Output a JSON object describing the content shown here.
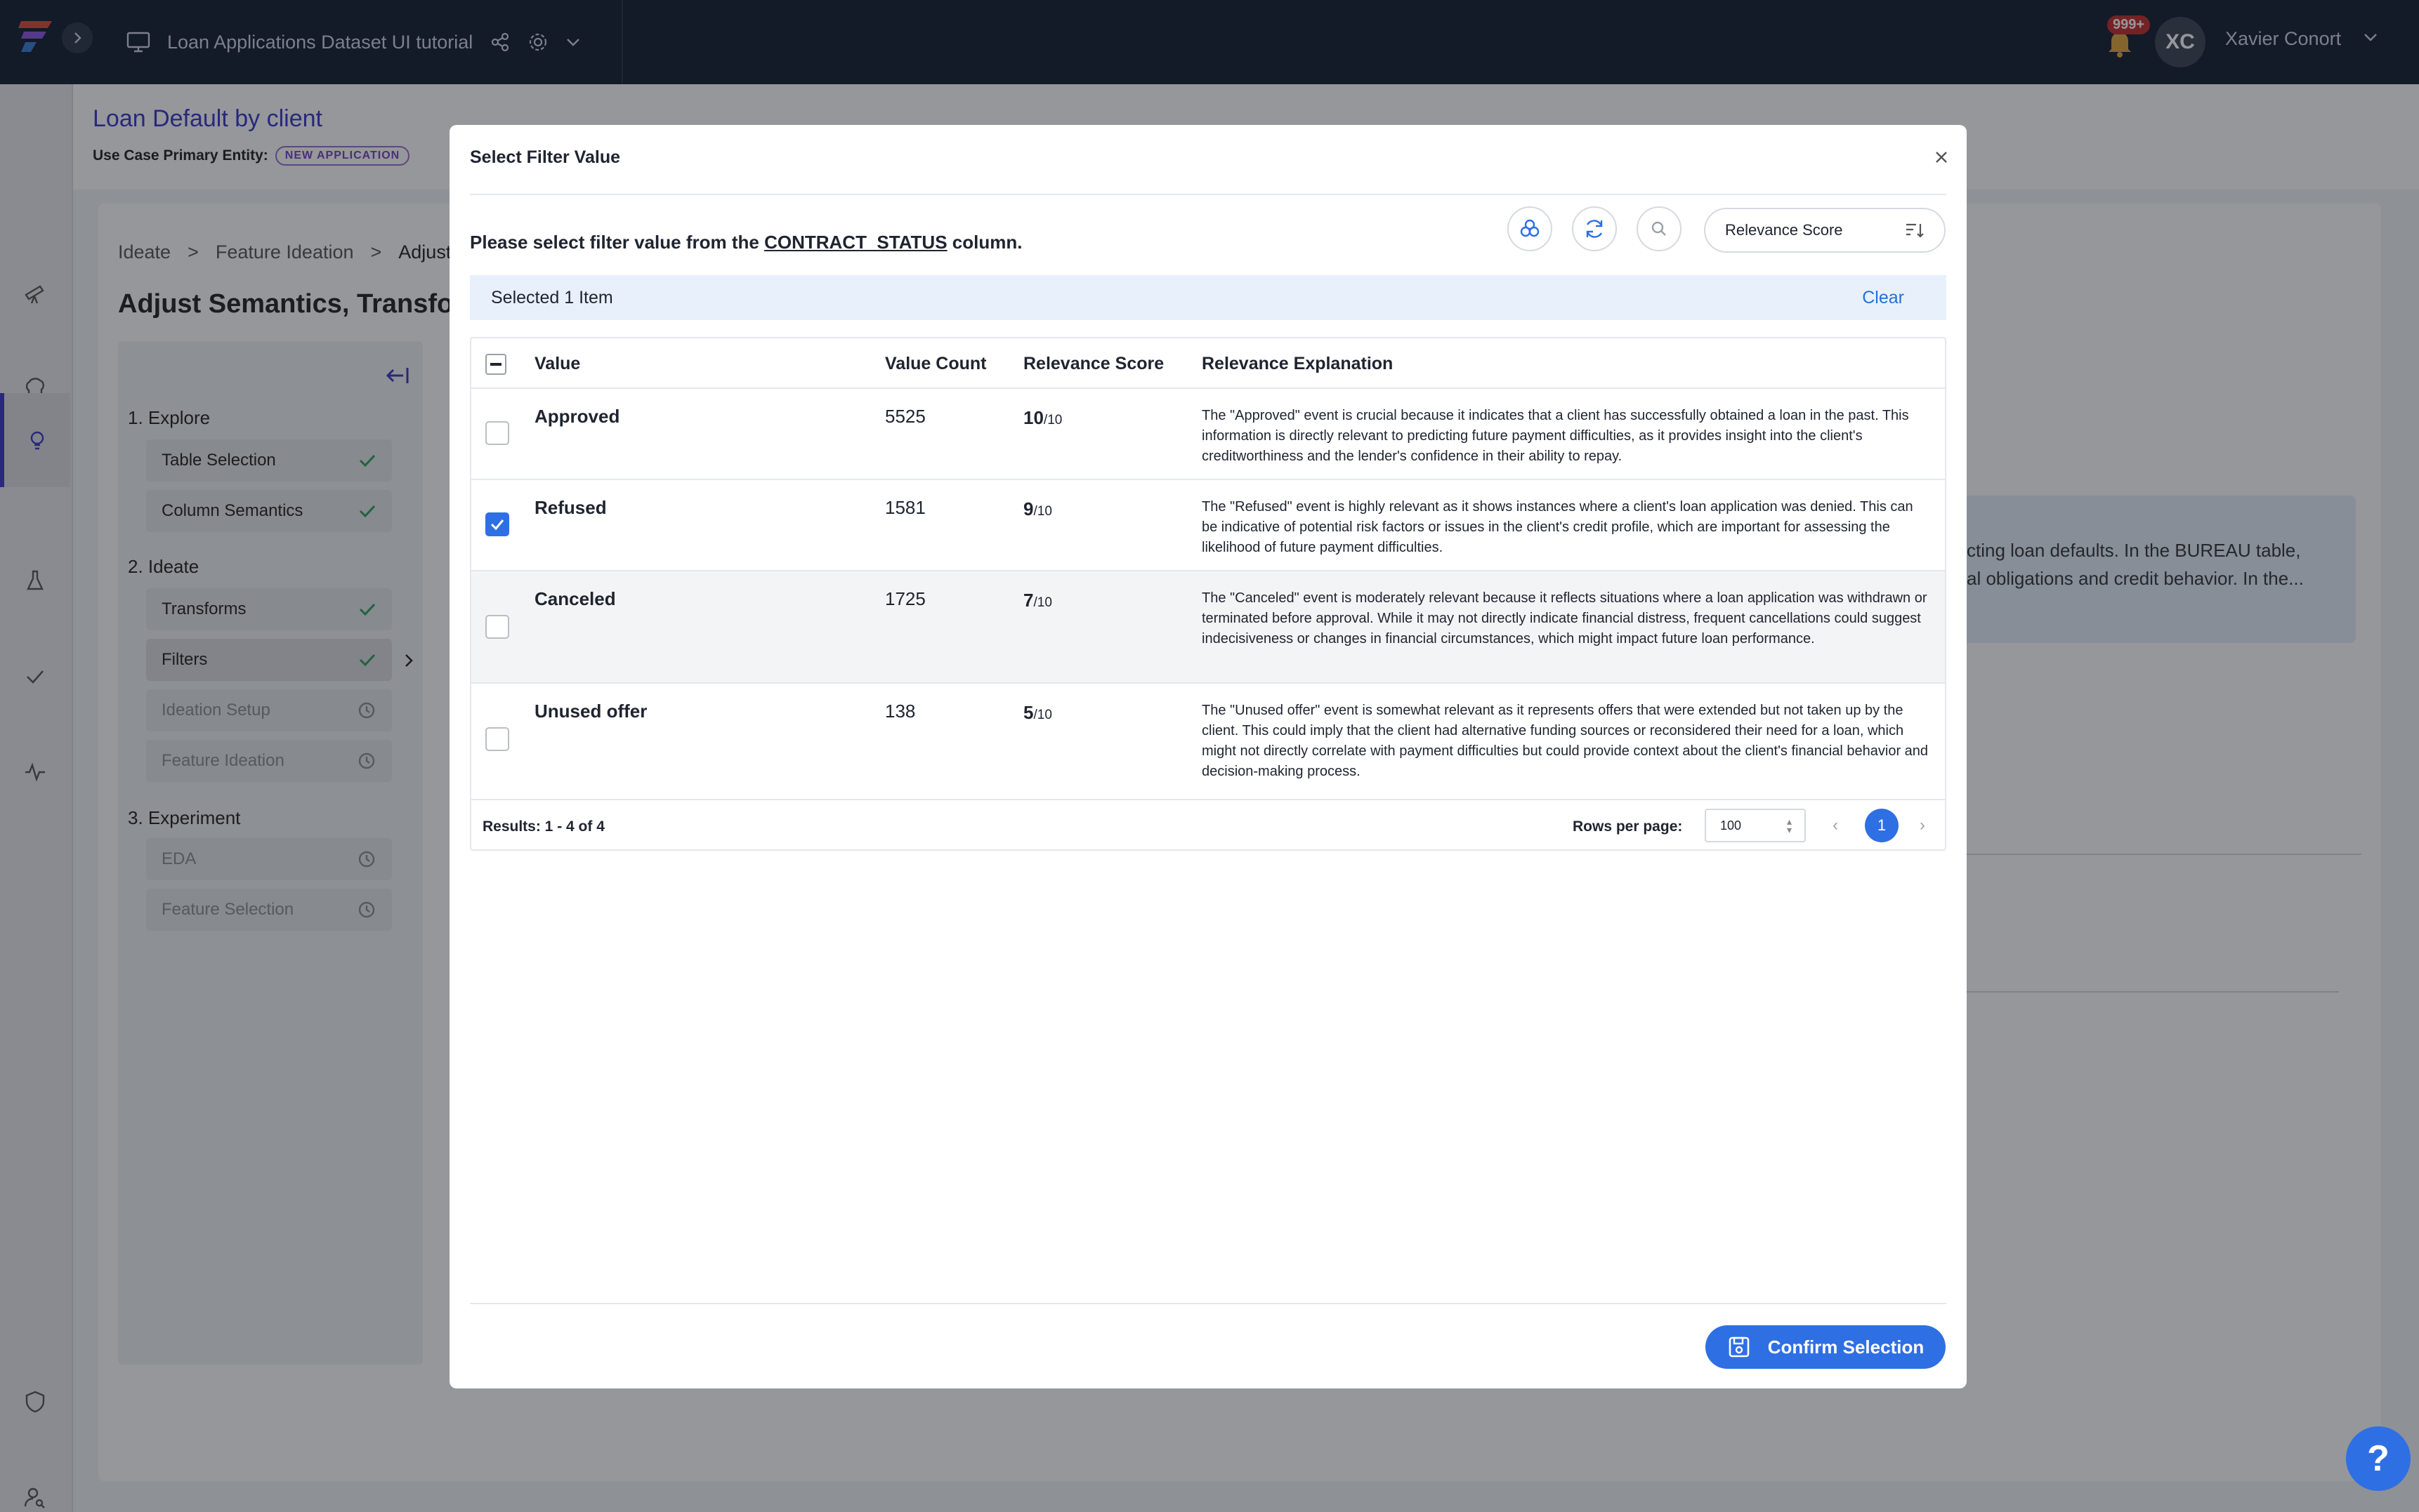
{
  "topbar": {
    "project_title": "Loan Applications Dataset UI tutorial",
    "notification_count": "999+",
    "user_initials": "XC",
    "user_name": "Xavier Conort"
  },
  "page": {
    "title": "Loan Default by client",
    "entity_label": "Use Case Primary Entity:",
    "entity_badge": "NEW APPLICATION",
    "breadcrumb": [
      "Ideate",
      ">",
      "Feature Ideation",
      ">",
      "Adjust S"
    ],
    "section_title": "Adjust Semantics, Transfor",
    "bg_info_lines": [
      "cting loan defaults. In the BUREAU table,",
      "al obligations and credit behavior. In the..."
    ]
  },
  "steps": {
    "groups": [
      {
        "label": "1. Explore"
      },
      {
        "label": "2. Ideate"
      },
      {
        "label": "3. Experiment"
      }
    ],
    "items": [
      {
        "label": "Table Selection",
        "status": "done"
      },
      {
        "label": "Column Semantics",
        "status": "done"
      },
      {
        "label": "Transforms",
        "status": "done"
      },
      {
        "label": "Filters",
        "status": "done"
      },
      {
        "label": "Ideation Setup",
        "status": "pending"
      },
      {
        "label": "Feature Ideation",
        "status": "pending"
      },
      {
        "label": "EDA",
        "status": "pending"
      },
      {
        "label": "Feature Selection",
        "status": "pending"
      }
    ]
  },
  "modal": {
    "title": "Select Filter Value",
    "prompt_prefix": "Please select filter value from the ",
    "column_name": "CONTRACT_STATUS",
    "prompt_suffix": " column.",
    "sort_label": "Relevance Score",
    "selected_text": "Selected 1 Item",
    "clear_label": "Clear",
    "columns": [
      "Value",
      "Value Count",
      "Relevance Score",
      "Relevance Explanation"
    ],
    "rows": [
      {
        "value": "Approved",
        "count": "5525",
        "score": "10",
        "score_max": "/10",
        "checked": false,
        "explanation": "The \"Approved\" event is crucial because it indicates that a client has successfully obtained a loan in the past. This information is directly relevant to predicting future payment difficulties, as it provides insight into the client's creditworthiness and the lender's confidence in their ability to repay."
      },
      {
        "value": "Refused",
        "count": "1581",
        "score": "9",
        "score_max": "/10",
        "checked": true,
        "explanation": "The \"Refused\" event is highly relevant as it shows instances where a client's loan application was denied. This can be indicative of potential risk factors or issues in the client's credit profile, which are important for assessing the likelihood of future payment difficulties."
      },
      {
        "value": "Canceled",
        "count": "1725",
        "score": "7",
        "score_max": "/10",
        "checked": false,
        "explanation": "The \"Canceled\" event is moderately relevant because it reflects situations where a loan application was withdrawn or terminated before approval. While it may not directly indicate financial distress, frequent cancellations could suggest indecisiveness or changes in financial circumstances, which might impact future loan performance."
      },
      {
        "value": "Unused offer",
        "count": "138",
        "score": "5",
        "score_max": "/10",
        "checked": false,
        "explanation": "The \"Unused offer\" event is somewhat relevant as it represents offers that were extended but not taken up by the client. This could imply that the client had alternative funding sources or reconsidered their need for a loan, which might not directly correlate with payment difficulties but could provide context about the client's financial behavior and decision-making process."
      }
    ],
    "results_text": "Results: 1 - 4 of 4",
    "rows_per_page_label": "Rows per page:",
    "rows_per_page_value": "100",
    "current_page": "1",
    "confirm_label": "Confirm Selection"
  },
  "help": {
    "label": "?"
  },
  "colors": {
    "accent": "#2f6fe4",
    "brand_purple": "#3a36c9",
    "topbar": "#131c31",
    "success": "#2e9e5b"
  }
}
